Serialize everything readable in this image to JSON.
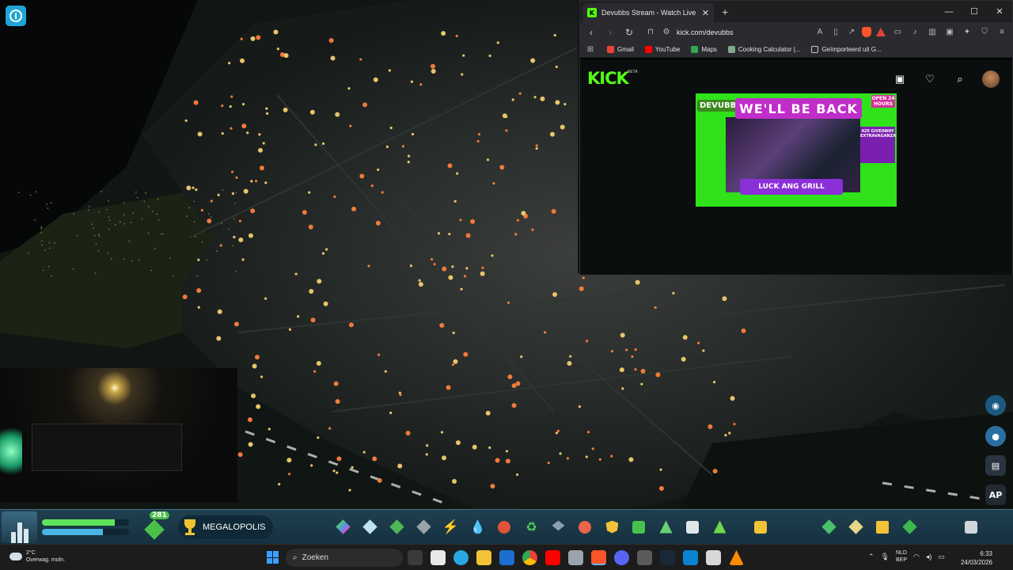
{
  "browser": {
    "tab_title": "Devubbs Stream - Watch Live o",
    "url": "kick.com/devubbs",
    "bookmarks": [
      "Gmail",
      "YouTube",
      "Maps",
      "Cooking Calculator |...",
      "Geïmporteerd uit G..."
    ],
    "window_controls": [
      "—",
      "☐",
      "✕"
    ]
  },
  "kick": {
    "logo": "KICK",
    "beta": "BETA",
    "stream": {
      "badge": "DEVUBBS",
      "banner": "WE'LL BE BACK",
      "open_label": "OPEN 24 HOURS",
      "side_label": "420 GIVEAWAY EXTRAVAGANZA",
      "bottom_label": "LUCK ANG GRILL"
    }
  },
  "hud": {
    "population_badge": "281",
    "milestone": "MEGALOPOLIS",
    "bars": [
      0.84,
      0.7
    ]
  },
  "side_tools": {
    "ap_label": "AP"
  },
  "taskbar": {
    "weather_temp": "2°C",
    "weather_desc": "Overwag. moln.",
    "search_placeholder": "Zoeken",
    "lang_line1": "NLD",
    "lang_line2": "BEP",
    "time": "6:33",
    "date": "24/03/2026"
  }
}
